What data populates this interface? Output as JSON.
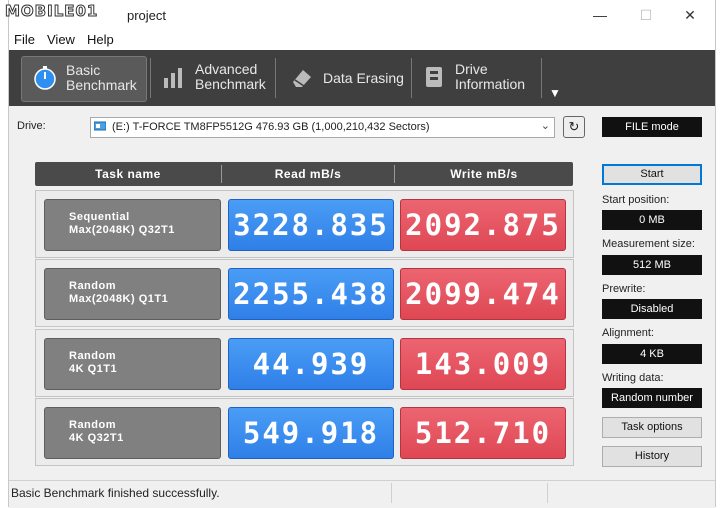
{
  "window": {
    "watermark": "MOBILE01",
    "title": "project",
    "minimize": "—",
    "maximize": "☐",
    "close": "✕"
  },
  "menu": {
    "file": "File",
    "view": "View",
    "help": "Help"
  },
  "toolbar": {
    "tabs": [
      {
        "line1": "Basic",
        "line2": "Benchmark",
        "icon": "stopwatch-icon",
        "active": true
      },
      {
        "line1": "Advanced",
        "line2": "Benchmark",
        "icon": "bar-chart-icon",
        "active": false
      },
      {
        "line1": "Data Erasing",
        "line2": "",
        "icon": "eraser-icon",
        "active": false
      },
      {
        "line1": "Drive",
        "line2": "Information",
        "icon": "drive-info-icon",
        "active": false
      }
    ],
    "more": "▼"
  },
  "drive": {
    "label": "Drive:",
    "selected": "(E:) T-FORCE TM8FP5512G  476.93 GB (1,000,210,432 Sectors)",
    "mode": "FILE mode"
  },
  "table": {
    "headers": {
      "task": "Task name",
      "read": "Read mB/s",
      "write": "Write mB/s"
    },
    "rows": [
      {
        "task": "Sequential\nMax(2048K) Q32T1",
        "read": "3228.835",
        "write": "2092.875"
      },
      {
        "task": "Random\nMax(2048K) Q1T1",
        "read": "2255.438",
        "write": "2099.474"
      },
      {
        "task": "Random\n4K Q1T1",
        "read": "44.939",
        "write": "143.009"
      },
      {
        "task": "Random\n4K Q32T1",
        "read": "549.918",
        "write": "512.710"
      }
    ]
  },
  "side": {
    "start": "Start",
    "start_position_label": "Start position:",
    "start_position": "0 MB",
    "measurement_size_label": "Measurement size:",
    "measurement_size": "512 MB",
    "prewrite_label": "Prewrite:",
    "prewrite": "Disabled",
    "alignment_label": "Alignment:",
    "alignment": "4 KB",
    "writing_data_label": "Writing data:",
    "writing_data": "Random number",
    "task_options": "Task options",
    "history": "History"
  },
  "status": {
    "message": "Basic Benchmark finished successfully."
  },
  "colors": {
    "read": "#2f7fe8",
    "write": "#df4754",
    "toolbar": "#3f3f3f",
    "accent": "#0078d7"
  }
}
